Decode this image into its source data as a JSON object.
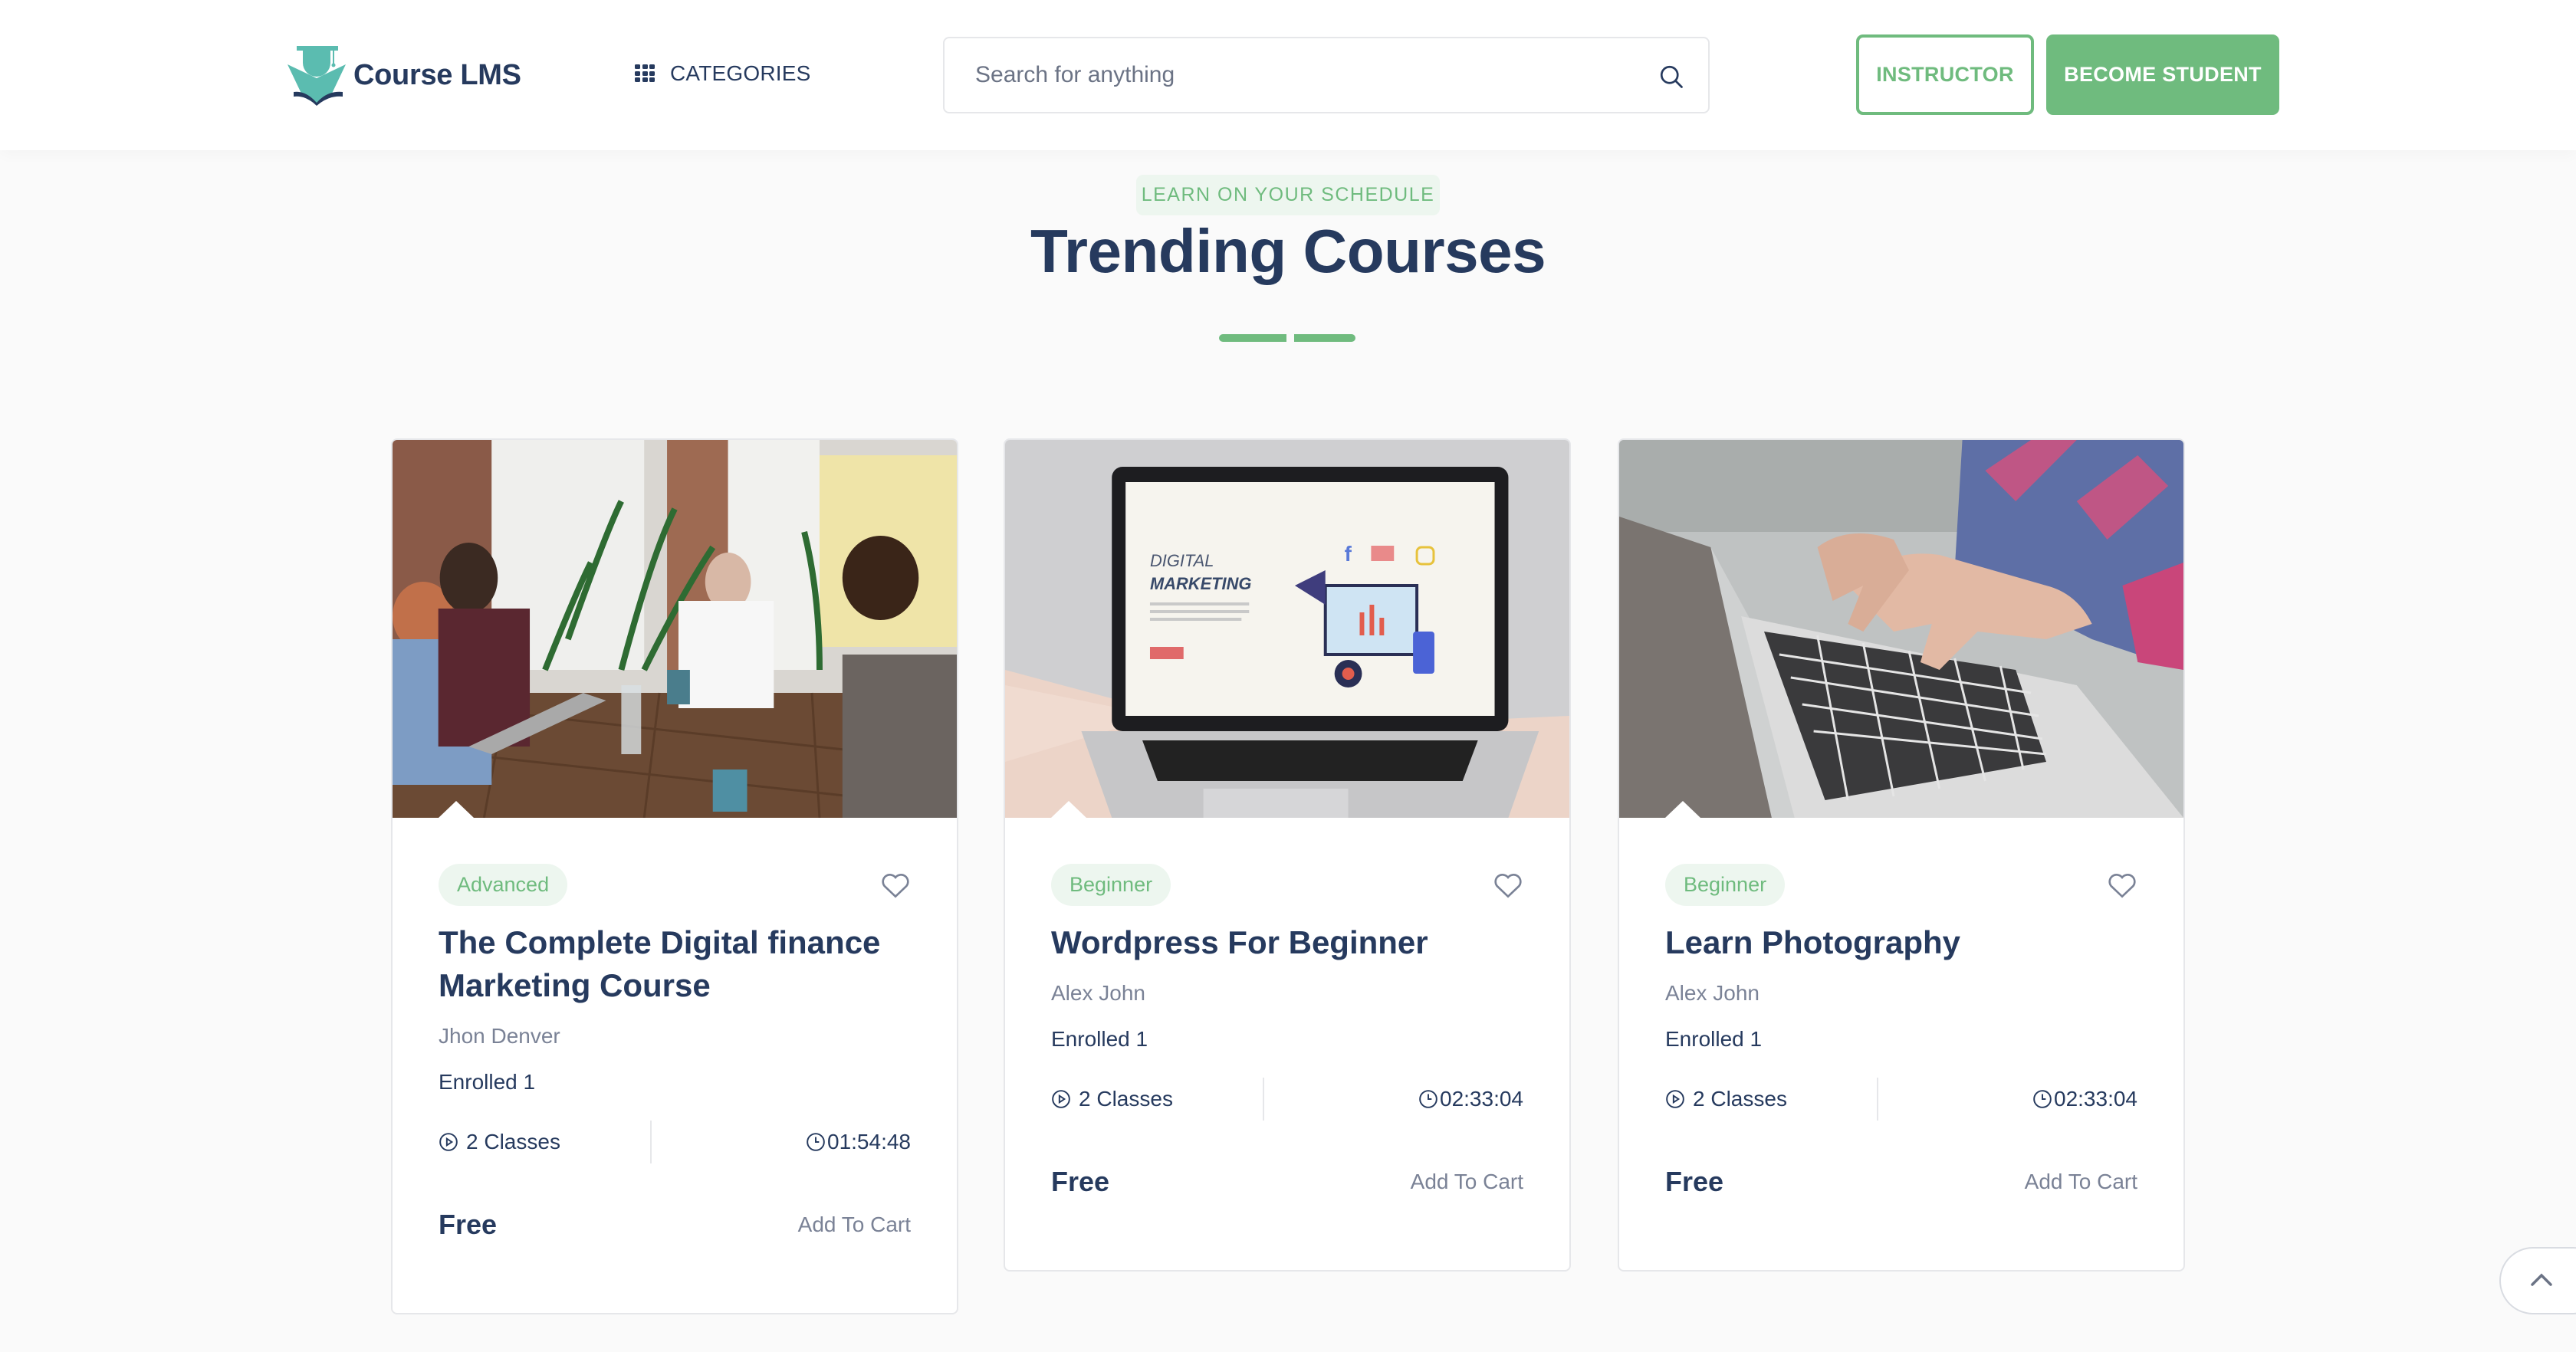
{
  "header": {
    "brand": "Course LMS",
    "categories_label": "CATEGORIES",
    "search_placeholder": "Search for anything",
    "search_value": "",
    "instructor_label": "INSTRUCTOR",
    "become_student_label": "BECOME STUDENT"
  },
  "section": {
    "eyebrow": "LEARN ON YOUR SCHEDULE",
    "title": "Trending Courses"
  },
  "colors": {
    "accent": "#6fbb7e",
    "accent_light": "#edf6ef",
    "heading": "#263a5e",
    "muted": "#7a8296",
    "logo_teal": "#5bbcb0"
  },
  "courses": [
    {
      "image": "team-meeting-photo",
      "level": "Advanced",
      "title": "The Complete Digital finance Marketing Course",
      "instructor": "Jhon Denver",
      "enrolled": "Enrolled 1",
      "classes": "2 Classes",
      "duration": "01:54:48",
      "price": "Free",
      "cta": "Add To Cart"
    },
    {
      "image": "digital-marketing-laptop-photo",
      "level": "Beginner",
      "title": "Wordpress For Beginner",
      "instructor": "Alex John",
      "enrolled": "Enrolled 1",
      "classes": "2 Classes",
      "duration": "02:33:04",
      "price": "Free",
      "cta": "Add To Cart"
    },
    {
      "image": "typing-on-laptop-photo",
      "level": "Beginner",
      "title": "Learn Photography",
      "instructor": "Alex John",
      "enrolled": "Enrolled 1",
      "classes": "2 Classes",
      "duration": "02:33:04",
      "price": "Free",
      "cta": "Add To Cart"
    }
  ],
  "icons": {
    "categories": "grid-icon",
    "search": "search-icon",
    "wishlist": "heart-icon",
    "classes": "play-circle-icon",
    "duration": "clock-icon",
    "scroll_top": "chevron-up-icon"
  }
}
